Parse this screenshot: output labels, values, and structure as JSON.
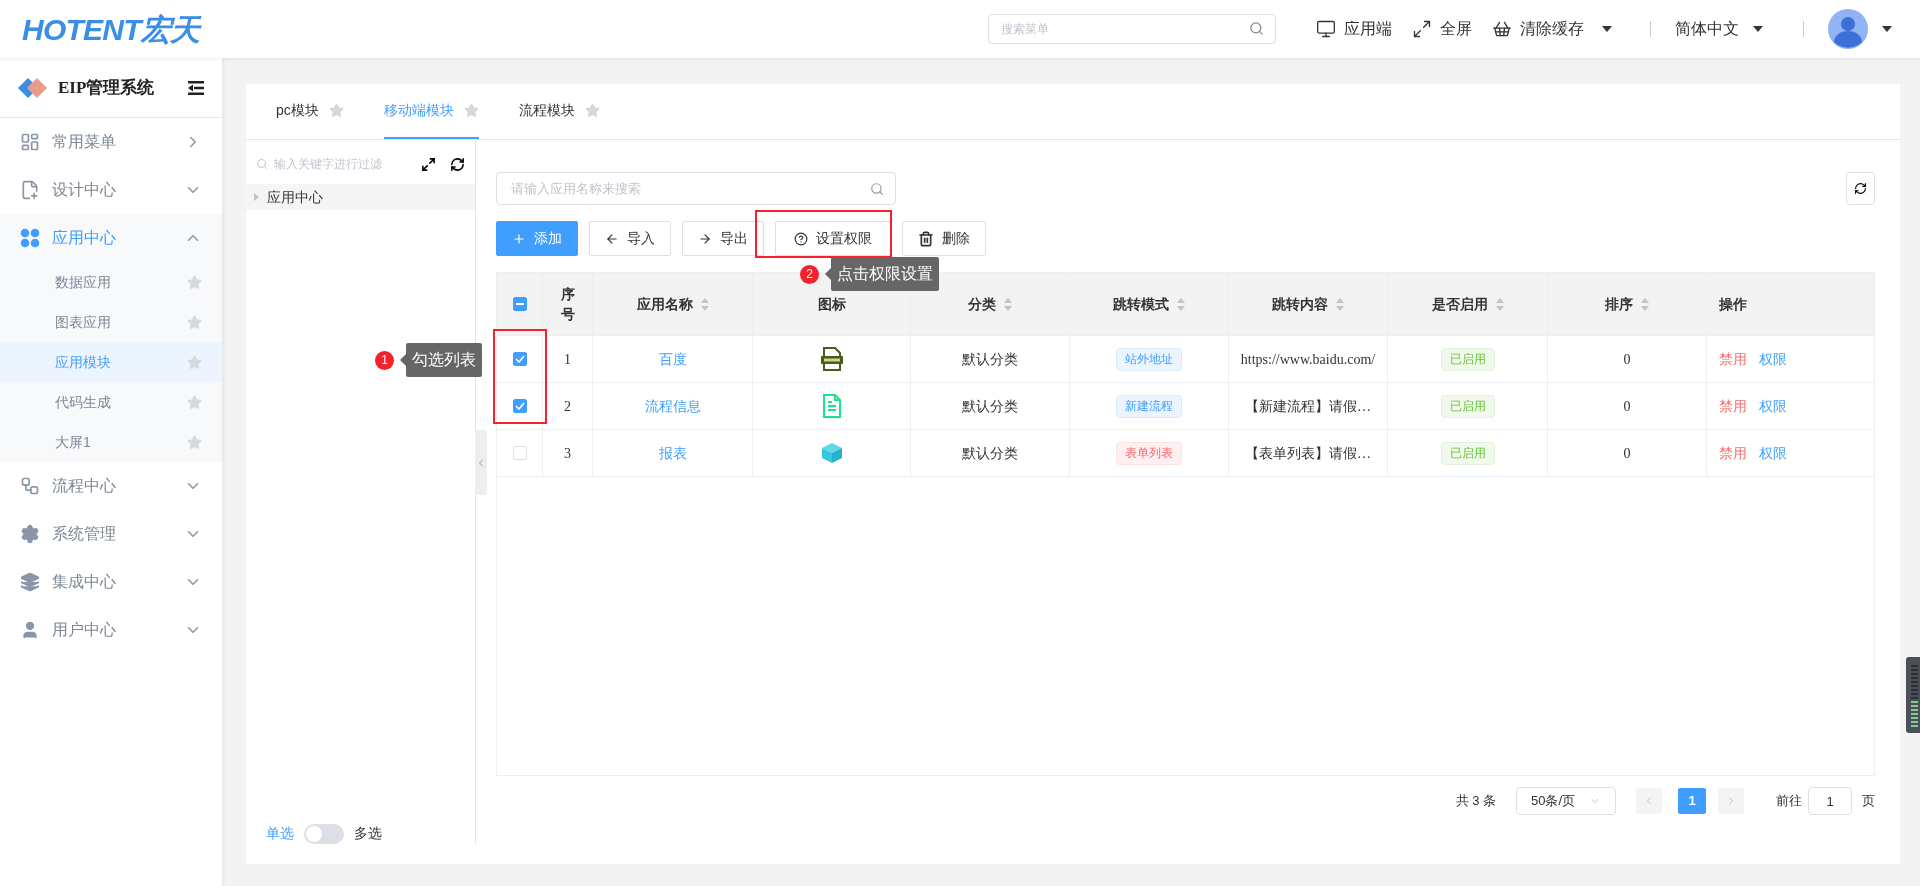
{
  "header": {
    "logo": "HOTENT宏天",
    "search": {
      "placeholder": "搜索菜单"
    },
    "actions": [
      {
        "label": "应用端",
        "dropdown": false
      },
      {
        "label": "全屏",
        "dropdown": false
      },
      {
        "label": "清除缓存",
        "dropdown": true
      }
    ],
    "language": "简体中文"
  },
  "sidebar": {
    "title": "EIP管理系统",
    "items": [
      {
        "label": "常用菜单",
        "expanded": false,
        "kind": "link"
      },
      {
        "label": "设计中心",
        "expanded": false,
        "kind": "group"
      },
      {
        "label": "应用中心",
        "expanded": true,
        "kind": "group",
        "children": [
          {
            "label": "数据应用",
            "selected": false
          },
          {
            "label": "图表应用",
            "selected": false
          },
          {
            "label": "应用模块",
            "selected": true
          },
          {
            "label": "代码生成",
            "selected": false
          },
          {
            "label": "大屏1",
            "selected": false
          }
        ]
      },
      {
        "label": "流程中心",
        "expanded": false,
        "kind": "group"
      },
      {
        "label": "系统管理",
        "expanded": false,
        "kind": "group"
      },
      {
        "label": "集成中心",
        "expanded": false,
        "kind": "group"
      },
      {
        "label": "用户中心",
        "expanded": false,
        "kind": "group"
      }
    ]
  },
  "tabs": [
    {
      "label": "pc模块",
      "selected": false
    },
    {
      "label": "移动端模块",
      "selected": true
    },
    {
      "label": "流程模块",
      "selected": false
    }
  ],
  "tree": {
    "search": {
      "placeholder": "输入关键字进行过滤"
    },
    "nodes": [
      {
        "label": "应用中心"
      }
    ],
    "mode": {
      "left": "单选",
      "right": "多选",
      "on": false
    }
  },
  "list": {
    "search": {
      "placeholder": "请输入应用名称来搜索"
    },
    "toolbar": [
      {
        "kind": "add",
        "label": "添加"
      },
      {
        "kind": "import",
        "label": "导入"
      },
      {
        "kind": "export",
        "label": "导出"
      },
      {
        "kind": "permission",
        "label": "设置权限"
      },
      {
        "kind": "delete",
        "label": "删除"
      }
    ],
    "table": {
      "select_all": {
        "indeterminate": true
      },
      "columns": [
        {
          "label": "序号",
          "sortable": false
        },
        {
          "label": "应用名称",
          "sortable": true
        },
        {
          "label": "图标",
          "sortable": false
        },
        {
          "label": "分类",
          "sortable": true
        },
        {
          "label": "跳转模式",
          "sortable": true
        },
        {
          "label": "跳转内容",
          "sortable": true
        },
        {
          "label": "是否启用",
          "sortable": true
        },
        {
          "label": "排序",
          "sortable": true
        },
        {
          "label": "操作",
          "sortable": false
        }
      ],
      "rows": [
        {
          "checked": true,
          "index": "1",
          "name": "百度",
          "icon": {
            "kind": "html"
          },
          "category": "默认分类",
          "mode": {
            "label": "站外地址",
            "kind": "info"
          },
          "content": "https://www.baidu.com/",
          "status": {
            "label": "已启用",
            "enabled": true
          },
          "sort": "0",
          "actions": [
            {
              "kind": "danger",
              "label": "禁用"
            },
            {
              "kind": "link",
              "label": "权限"
            }
          ]
        },
        {
          "checked": true,
          "index": "2",
          "name": "流程信息",
          "icon": {
            "kind": "doc"
          },
          "category": "默认分类",
          "mode": {
            "label": "新建流程",
            "kind": "info"
          },
          "content": "【新建流程】请假…",
          "status": {
            "label": "已启用",
            "enabled": true
          },
          "sort": "0",
          "actions": [
            {
              "kind": "danger",
              "label": "禁用"
            },
            {
              "kind": "link",
              "label": "权限"
            }
          ]
        },
        {
          "checked": false,
          "index": "3",
          "name": "报表",
          "icon": {
            "kind": "cube"
          },
          "category": "默认分类",
          "mode": {
            "label": "表单列表",
            "kind": "danger"
          },
          "content": "【表单列表】请假…",
          "status": {
            "label": "已启用",
            "enabled": true
          },
          "sort": "0",
          "actions": [
            {
              "kind": "danger",
              "label": "禁用"
            },
            {
              "kind": "link",
              "label": "权限"
            }
          ]
        }
      ]
    },
    "pagination": {
      "total": "共 3 条",
      "page_size": "50条/页",
      "pages": [
        {
          "label": "1",
          "selected": true
        }
      ],
      "goto_label": "前往",
      "goto_value": "1",
      "goto_suffix": "页"
    }
  },
  "annotations": [
    {
      "number": "1",
      "text": "勾选列表"
    },
    {
      "number": "2",
      "text": "点击权限设置"
    }
  ]
}
